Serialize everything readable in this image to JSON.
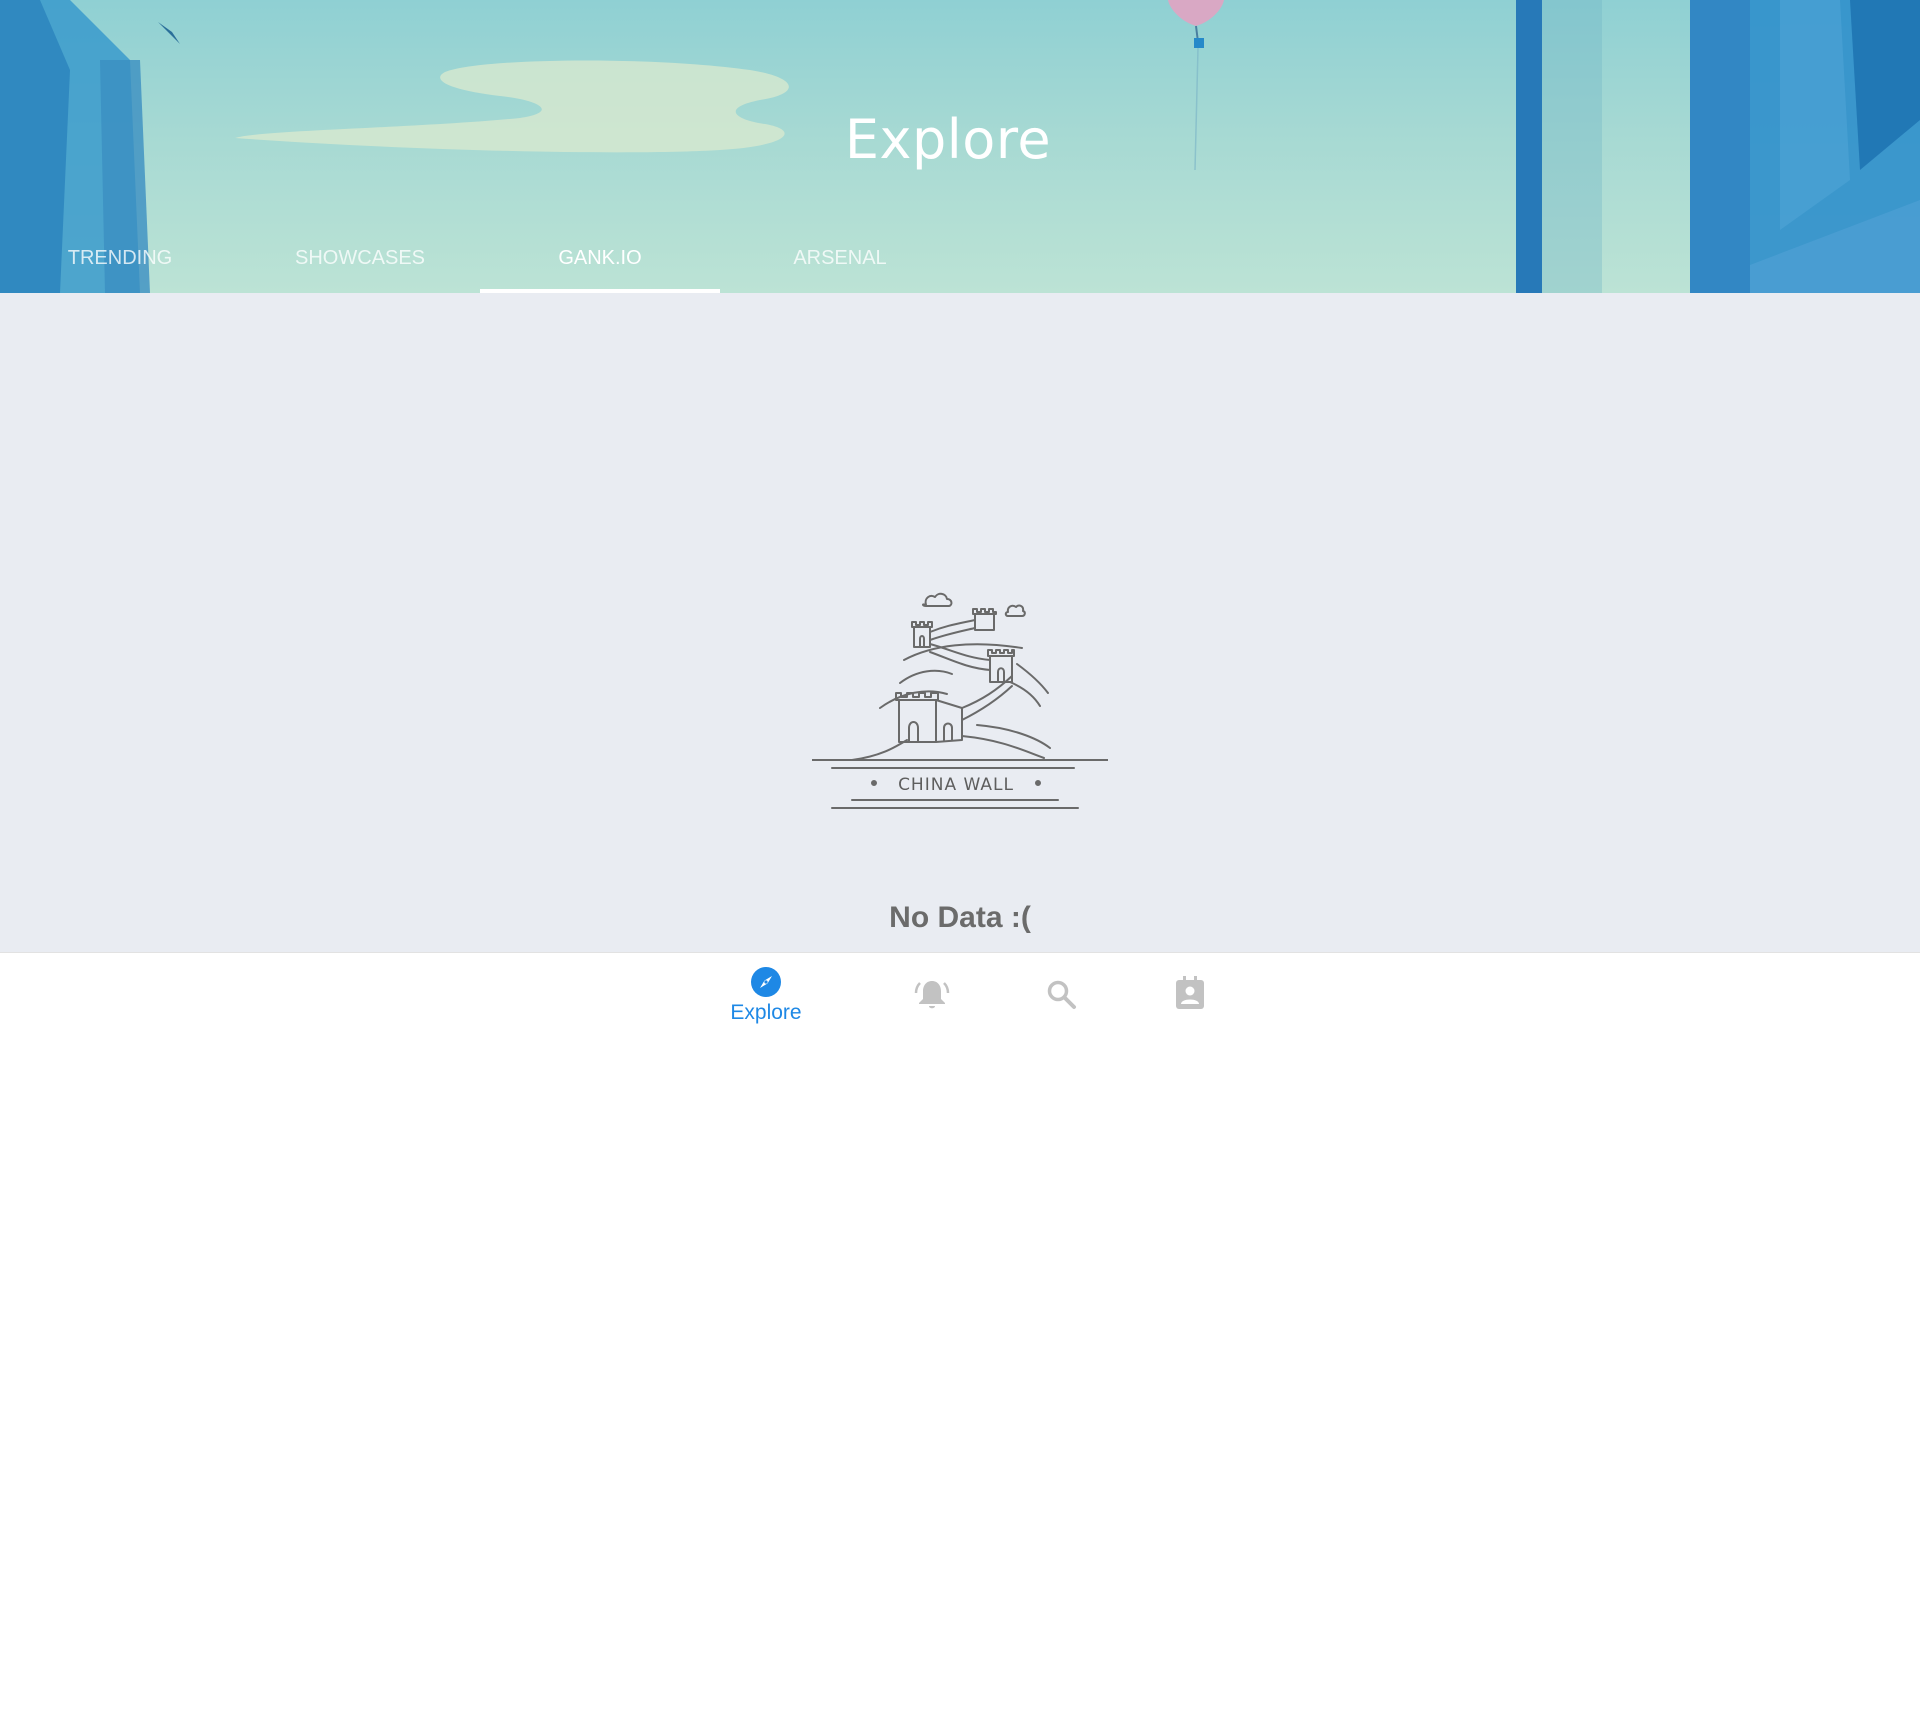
{
  "header": {
    "title": "Explore",
    "tabs": [
      {
        "label": "TRENDING",
        "active": false
      },
      {
        "label": "SHOWCASES",
        "active": false
      },
      {
        "label": "GANK.IO",
        "active": true
      },
      {
        "label": "ARSENAL",
        "active": false
      }
    ]
  },
  "content": {
    "illustration_caption": "CHINA WALL",
    "empty_message": "No Data :("
  },
  "bottom_nav": {
    "items": [
      {
        "label": "Explore",
        "icon": "compass-icon",
        "active": true
      },
      {
        "label": "",
        "icon": "bell-ringing-icon",
        "active": false
      },
      {
        "label": "",
        "icon": "search-icon",
        "active": false
      },
      {
        "label": "",
        "icon": "contact-card-icon",
        "active": false
      }
    ]
  },
  "colors": {
    "accent": "#1e88e5",
    "inactive_icon": "#c2c2c2",
    "content_bg": "#e9ecf2",
    "header_sky": "#9fd6d4"
  }
}
